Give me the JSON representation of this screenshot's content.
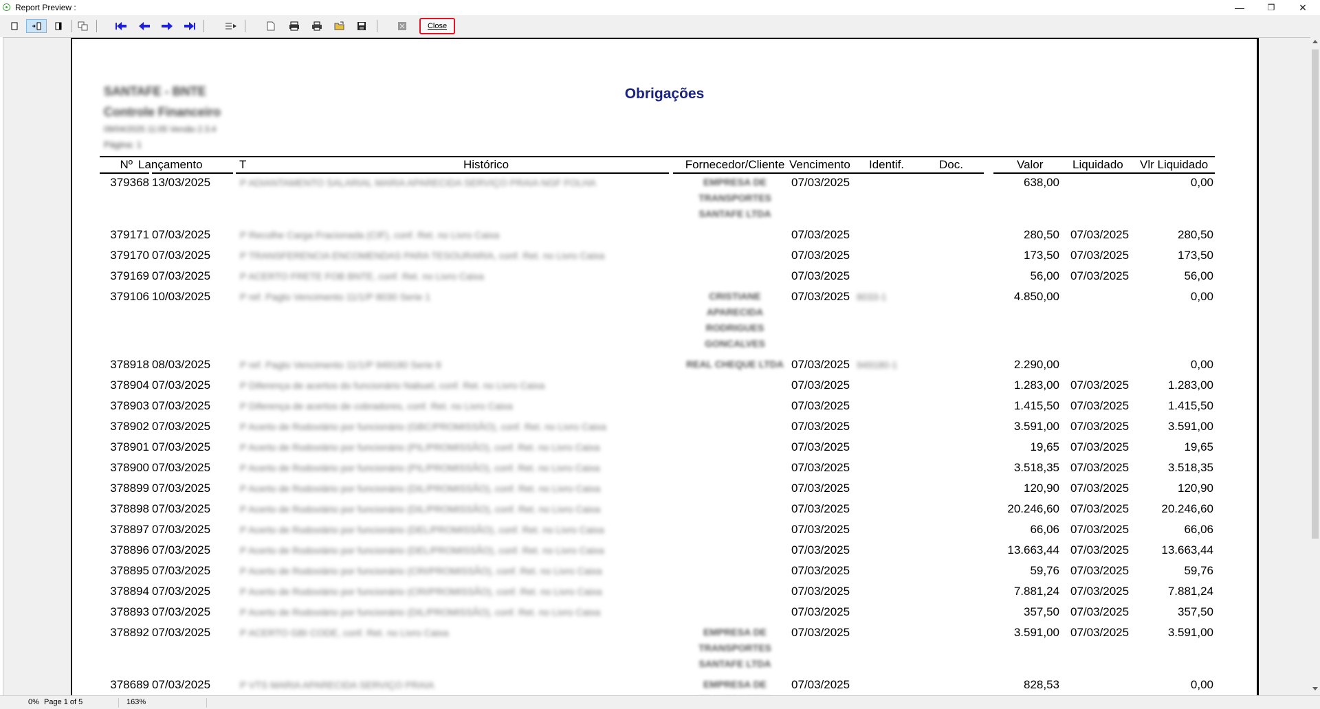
{
  "window": {
    "title": "Report Preview :",
    "minimize": "—",
    "restore": "❐",
    "close": "✕"
  },
  "toolbar": {
    "close_label": "Close",
    "icons": [
      "page-width-icon",
      "fit-page-icon",
      "two-pages-icon",
      "multi-page-icon",
      "first-page-icon",
      "prev-page-icon",
      "next-page-icon",
      "last-page-icon",
      "goto-page-icon",
      "new-page-icon",
      "print-setup-icon",
      "print-icon",
      "open-icon",
      "save-icon",
      "export-icon"
    ]
  },
  "report": {
    "company_line1": "SANTAFE - BNTE",
    "company_line2": "Controle Financeiro",
    "company_line3": "09/04/2025 11:05     Versão 2.3.4",
    "company_line4": "Página:     1",
    "title": "Obrigações",
    "columns": {
      "num": "Nº",
      "lancamento": "Lançamento",
      "tipo": "T",
      "historico": "Histórico",
      "fornecedor": "Fornecedor/Cliente",
      "vencimento": "Vencimento",
      "identif": "Identif.",
      "doc": "Doc.",
      "valor": "Valor",
      "liquidado": "Liquidado",
      "vlr_liquidado": "Vlr Liquidado"
    },
    "rows": [
      {
        "num": "379368",
        "lanc": "13/03/2025",
        "hist": "P ADIANTAMENTO SALARIAL MARIA APARECIDA SERVIÇO PRAIA NGF FOLHA",
        "forn": "EMPRESA DE|TRANSPORTES|SANTAFE LTDA",
        "venc": "07/03/2025",
        "ident": "",
        "valor": "638,00",
        "liq": "",
        "vlr_liq": "0,00"
      },
      {
        "num": "379171",
        "lanc": "07/03/2025",
        "hist": "P Recolhe Carga Fracionada (CIF), conf. Ret. no Livro Caixa",
        "forn": "",
        "venc": "07/03/2025",
        "ident": "",
        "valor": "280,50",
        "liq": "07/03/2025",
        "vlr_liq": "280,50"
      },
      {
        "num": "379170",
        "lanc": "07/03/2025",
        "hist": "P TRANSFERENCIA ENCOMENDAS PARA TESOURARIA, conf. Ret. no Livro Caixa",
        "forn": "",
        "venc": "07/03/2025",
        "ident": "",
        "valor": "173,50",
        "liq": "07/03/2025",
        "vlr_liq": "173,50"
      },
      {
        "num": "379169",
        "lanc": "07/03/2025",
        "hist": "P ACERTO FRETE FOB BNTE, conf. Ret. no Livro Caixa",
        "forn": "",
        "venc": "07/03/2025",
        "ident": "",
        "valor": "56,00",
        "liq": "07/03/2025",
        "vlr_liq": "56,00"
      },
      {
        "num": "379106",
        "lanc": "10/03/2025",
        "hist": "P ref. Pagto Vencimento 11/1/P 8030 Serie 1",
        "forn": "CRISTIANE|APARECIDA|RODRIGUES|GONCALVES",
        "venc": "07/03/2025",
        "ident": "8033-1",
        "valor": "4.850,00",
        "liq": "",
        "vlr_liq": "0,00"
      },
      {
        "num": "378918",
        "lanc": "08/03/2025",
        "hist": "P ref. Pagto Vencimento 11/1/P 949180 Serie 8",
        "forn": "REAL CHEQUE LTDA",
        "venc": "07/03/2025",
        "ident": "949180-1",
        "valor": "2.290,00",
        "liq": "",
        "vlr_liq": "0,00"
      },
      {
        "num": "378904",
        "lanc": "07/03/2025",
        "hist": "P Diferença de acertos do funcionário Nabuel, conf. Ret. no Livro Caixa",
        "forn": "",
        "venc": "07/03/2025",
        "ident": "",
        "valor": "1.283,00",
        "liq": "07/03/2025",
        "vlr_liq": "1.283,00"
      },
      {
        "num": "378903",
        "lanc": "07/03/2025",
        "hist": "P Diferença de acertos de cobradores, conf. Ret. no Livro Caixa",
        "forn": "",
        "venc": "07/03/2025",
        "ident": "",
        "valor": "1.415,50",
        "liq": "07/03/2025",
        "vlr_liq": "1.415,50"
      },
      {
        "num": "378902",
        "lanc": "07/03/2025",
        "hist": "P Acerto de Rodoviário por funcionário (GBC/PROMISSÃO), conf. Ret. no Livro Caixa",
        "forn": "",
        "venc": "07/03/2025",
        "ident": "",
        "valor": "3.591,00",
        "liq": "07/03/2025",
        "vlr_liq": "3.591,00"
      },
      {
        "num": "378901",
        "lanc": "07/03/2025",
        "hist": "P Acerto de Rodoviário por funcionário (PIL/PROMISSÃO), conf. Ret. no Livro Caixa",
        "forn": "",
        "venc": "07/03/2025",
        "ident": "",
        "valor": "19,65",
        "liq": "07/03/2025",
        "vlr_liq": "19,65"
      },
      {
        "num": "378900",
        "lanc": "07/03/2025",
        "hist": "P Acerto de Rodoviário por funcionário (PIL/PROMISSÃO), conf. Ret. no Livro Caixa",
        "forn": "",
        "venc": "07/03/2025",
        "ident": "",
        "valor": "3.518,35",
        "liq": "07/03/2025",
        "vlr_liq": "3.518,35"
      },
      {
        "num": "378899",
        "lanc": "07/03/2025",
        "hist": "P Acerto de Rodoviário por funcionário (DIL/PROMISSÃO), conf. Ret. no Livro Caixa",
        "forn": "",
        "venc": "07/03/2025",
        "ident": "",
        "valor": "120,90",
        "liq": "07/03/2025",
        "vlr_liq": "120,90"
      },
      {
        "num": "378898",
        "lanc": "07/03/2025",
        "hist": "P Acerto de Rodoviário por funcionário (DIL/PROMISSÃO), conf. Ret. no Livro Caixa",
        "forn": "",
        "venc": "07/03/2025",
        "ident": "",
        "valor": "20.246,60",
        "liq": "07/03/2025",
        "vlr_liq": "20.246,60"
      },
      {
        "num": "378897",
        "lanc": "07/03/2025",
        "hist": "P Acerto de Rodoviário por funcionário (DEL/PROMISSÃO), conf. Ret. no Livro Caixa",
        "forn": "",
        "venc": "07/03/2025",
        "ident": "",
        "valor": "66,06",
        "liq": "07/03/2025",
        "vlr_liq": "66,06"
      },
      {
        "num": "378896",
        "lanc": "07/03/2025",
        "hist": "P Acerto de Rodoviário por funcionário (DEL/PROMISSÃO), conf. Ret. no Livro Caixa",
        "forn": "",
        "venc": "07/03/2025",
        "ident": "",
        "valor": "13.663,44",
        "liq": "07/03/2025",
        "vlr_liq": "13.663,44"
      },
      {
        "num": "378895",
        "lanc": "07/03/2025",
        "hist": "P Acerto de Rodoviário por funcionário (CRI/PROMISSÃO), conf. Ret. no Livro Caixa",
        "forn": "",
        "venc": "07/03/2025",
        "ident": "",
        "valor": "59,76",
        "liq": "07/03/2025",
        "vlr_liq": "59,76"
      },
      {
        "num": "378894",
        "lanc": "07/03/2025",
        "hist": "P Acerto de Rodoviário por funcionário (CRI/PROMISSÃO), conf. Ret. no Livro Caixa",
        "forn": "",
        "venc": "07/03/2025",
        "ident": "",
        "valor": "7.881,24",
        "liq": "07/03/2025",
        "vlr_liq": "7.881,24"
      },
      {
        "num": "378893",
        "lanc": "07/03/2025",
        "hist": "P Acerto de Rodoviário por funcionário (DIL/PROMISSÃO), conf. Ret. no Livro Caixa",
        "forn": "",
        "venc": "07/03/2025",
        "ident": "",
        "valor": "357,50",
        "liq": "07/03/2025",
        "vlr_liq": "357,50"
      },
      {
        "num": "378892",
        "lanc": "07/03/2025",
        "hist": "P ACERTO GBI CODE, conf. Ret. no Livro Caixa",
        "forn": "EMPRESA DE|TRANSPORTES|SANTAFE LTDA",
        "venc": "07/03/2025",
        "ident": "",
        "valor": "3.591,00",
        "liq": "07/03/2025",
        "vlr_liq": "3.591,00"
      },
      {
        "num": "378689",
        "lanc": "07/03/2025",
        "hist": "P VTS MARIA APARECIDA SERVIÇO PRAIA",
        "forn": "EMPRESA DE|TRANSPORTES",
        "venc": "07/03/2025",
        "ident": "",
        "valor": "828,53",
        "liq": "",
        "vlr_liq": "0,00"
      }
    ]
  },
  "status": {
    "progress": "0%",
    "page": "Page 1 of 5",
    "zoom": "163%"
  },
  "colors": {
    "title": "#1a237e",
    "close_border": "#e81123",
    "nav_arrows": "#1f1fd6"
  }
}
